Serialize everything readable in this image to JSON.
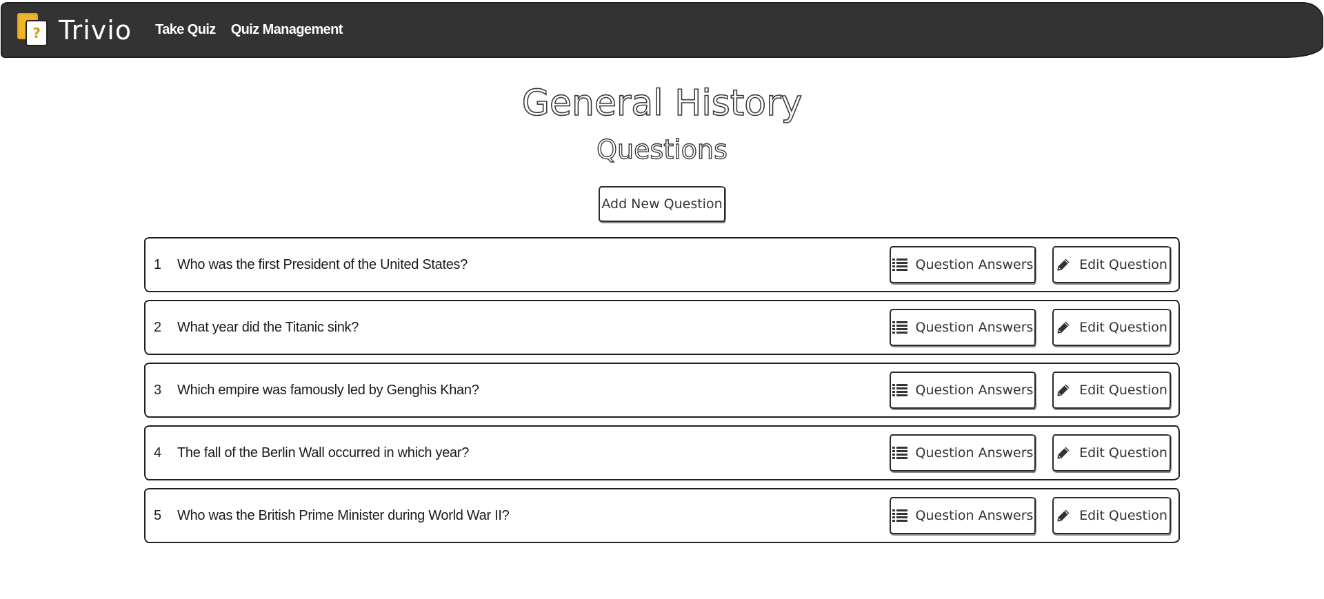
{
  "navbar": {
    "brand": "Trivio",
    "logo_glyph": "?",
    "links": [
      {
        "label": "Take Quiz"
      },
      {
        "label": "Quiz Management"
      }
    ]
  },
  "page": {
    "title": "General History",
    "subtitle": "Questions",
    "add_button_label": "Add New Question"
  },
  "questions": [
    {
      "number": "1",
      "text": "Who was the first President of the United States?",
      "answers_label": "Question Answers",
      "edit_label": "Edit Question"
    },
    {
      "number": "2",
      "text": "What year did the Titanic sink?",
      "answers_label": "Question Answers",
      "edit_label": "Edit Question"
    },
    {
      "number": "3",
      "text": "Which empire was famously led by Genghis Khan?",
      "answers_label": "Question Answers",
      "edit_label": "Edit Question"
    },
    {
      "number": "4",
      "text": "The fall of the Berlin Wall occurred in which year?",
      "answers_label": "Question Answers",
      "edit_label": "Edit Question"
    },
    {
      "number": "5",
      "text": "Who was the British Prime Minister during World War II?",
      "answers_label": "Question Answers",
      "edit_label": "Edit Question"
    }
  ],
  "icons": {
    "answers": "list-icon",
    "edit": "pencil-icon"
  },
  "colors": {
    "navbar_bg": "#333333",
    "logo_accent": "#f0b429"
  }
}
